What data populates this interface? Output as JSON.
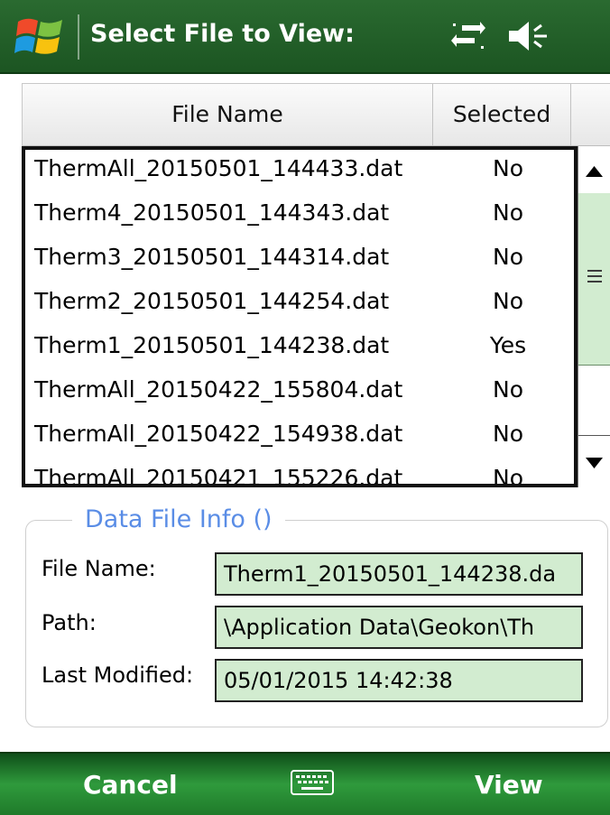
{
  "titlebar": {
    "title": "Select File to View:",
    "icons": [
      "windows-flag-icon",
      "connectivity-icon",
      "speaker-muted-icon"
    ]
  },
  "table": {
    "columns": [
      "File Name",
      "Selected"
    ],
    "rows": [
      {
        "name": "ThermAll_20150501_144433.dat",
        "selected": "No"
      },
      {
        "name": "Therm4_20150501_144343.dat",
        "selected": "No"
      },
      {
        "name": "Therm3_20150501_144314.dat",
        "selected": "No"
      },
      {
        "name": "Therm2_20150501_144254.dat",
        "selected": "No"
      },
      {
        "name": "Therm1_20150501_144238.dat",
        "selected": "Yes"
      },
      {
        "name": "ThermAll_20150422_155804.dat",
        "selected": "No"
      },
      {
        "name": "ThermAll_20150422_154938.dat",
        "selected": "No"
      },
      {
        "name": "ThermAll_20150421_155226.dat",
        "selected": "No"
      }
    ]
  },
  "info": {
    "legend": "Data File Info ()",
    "file_name_label": "File Name:",
    "file_name_value": "Therm1_20150501_144238.da",
    "path_label": "Path:",
    "path_value": "\\Application Data\\Geokon\\Th",
    "last_modified_label": "Last Modified:",
    "last_modified_value": "05/01/2015  14:42:38"
  },
  "bottombar": {
    "cancel_label": "Cancel",
    "view_label": "View",
    "keyboard_icon": "keyboard-icon"
  },
  "colors": {
    "title_bg": "#1f5b25",
    "field_bg": "#d2ecd0",
    "legend_text": "#5a8de6",
    "bottom_bar": "#2f9a3c"
  }
}
